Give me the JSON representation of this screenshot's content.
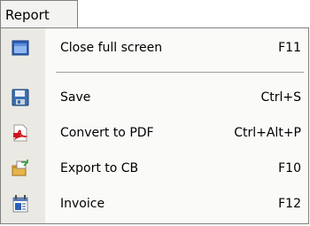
{
  "menubar": {
    "report_label": "Report"
  },
  "menu": {
    "items": [
      {
        "label": "Close full screen",
        "shortcut": "F11",
        "icon": "window-icon"
      },
      {
        "label": "Save",
        "shortcut": "Ctrl+S",
        "icon": "floppy-disk-icon"
      },
      {
        "label": "Convert to PDF",
        "shortcut": "Ctrl+Alt+P",
        "icon": "pdf-icon"
      },
      {
        "label": "Export to CB",
        "shortcut": "F10",
        "icon": "export-icon"
      },
      {
        "label": "Invoice",
        "shortcut": "F12",
        "icon": "invoice-icon"
      }
    ]
  }
}
